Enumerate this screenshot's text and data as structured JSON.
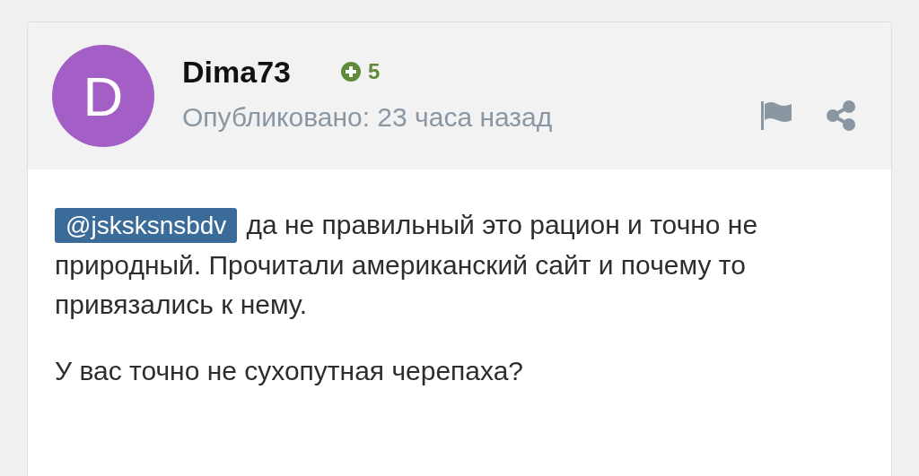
{
  "post": {
    "author": {
      "initial": "D",
      "name": "Dima73",
      "reputation": "5"
    },
    "published": "Опубликовано: 23 часа назад",
    "paragraphs": [
      {
        "mention": "@jsksksnsbdv",
        "text": "да не правильный это рацион и точно не природный. Прочитали американский сайт и почему то привязались к нему."
      },
      {
        "text": "У вас точно не сухопутная черепаха?"
      }
    ]
  }
}
